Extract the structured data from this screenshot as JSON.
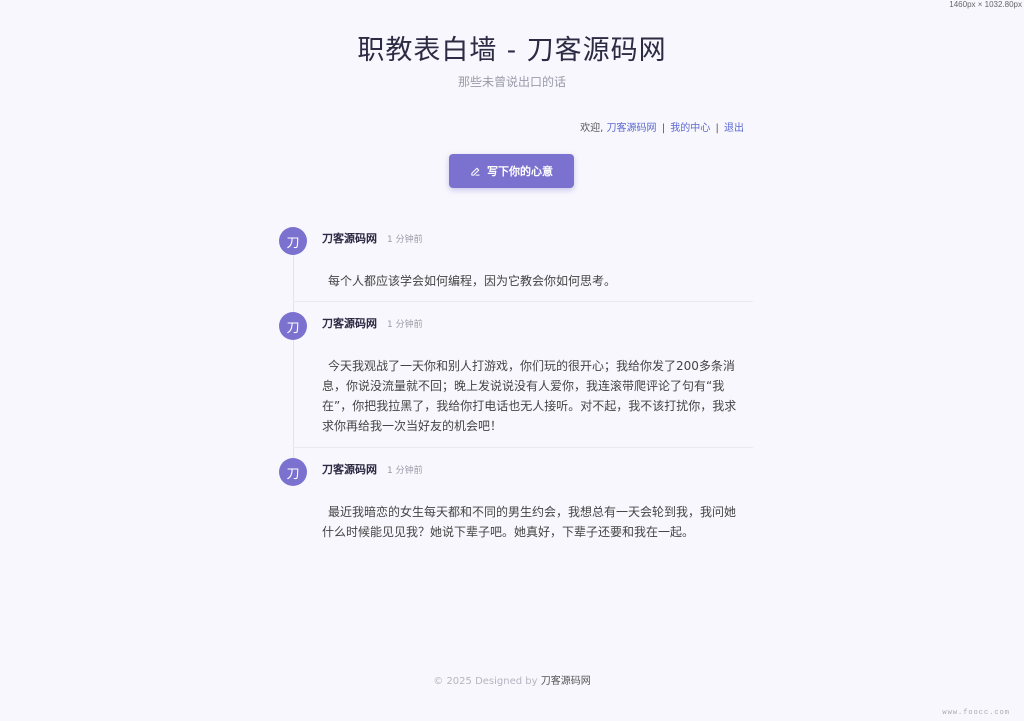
{
  "screen_size_label": "1460px × 1032.80px",
  "site": {
    "title": "职教表白墙 - 刀客源码网",
    "subtitle": "那些未曾说出口的话"
  },
  "userbar": {
    "welcome": "欢迎,",
    "username": "刀客源码网",
    "separator": "|",
    "my_center": "我的中心",
    "logout": "退出"
  },
  "write_button": {
    "label": "写下你的心意",
    "icon": "pencil-icon"
  },
  "posts": [
    {
      "avatar_char": "刀",
      "author": "刀客源码网",
      "time": "1 分钟前",
      "content": "每个人都应该学会如何编程，因为它教会你如何思考。"
    },
    {
      "avatar_char": "刀",
      "author": "刀客源码网",
      "time": "1 分钟前",
      "content": "今天我观战了一天你和别人打游戏，你们玩的很开心；我给你发了200多条消息，你说没流量就不回；晚上发说说没有人爱你，我连滚带爬评论了句有“我在”，你把我拉黑了，我给你打电话也无人接听。对不起，我不该打扰你，我求求你再给我一次当好友的机会吧！"
    },
    {
      "avatar_char": "刀",
      "author": "刀客源码网",
      "time": "1 分钟前",
      "content": "最近我暗恋的女生每天都和不同的男生约会，我想总有一天会轮到我，我问她什么时候能见见我？她说下辈子吧。她真好，下辈子还要和我在一起。"
    }
  ],
  "footer": {
    "prefix": "© 2025 Designed by",
    "brand": "刀客源码网"
  },
  "watermark": "www.foocc.com",
  "colors": {
    "accent": "#7b72cf",
    "link": "#5b6ad0",
    "background": "#f8f7fd"
  }
}
